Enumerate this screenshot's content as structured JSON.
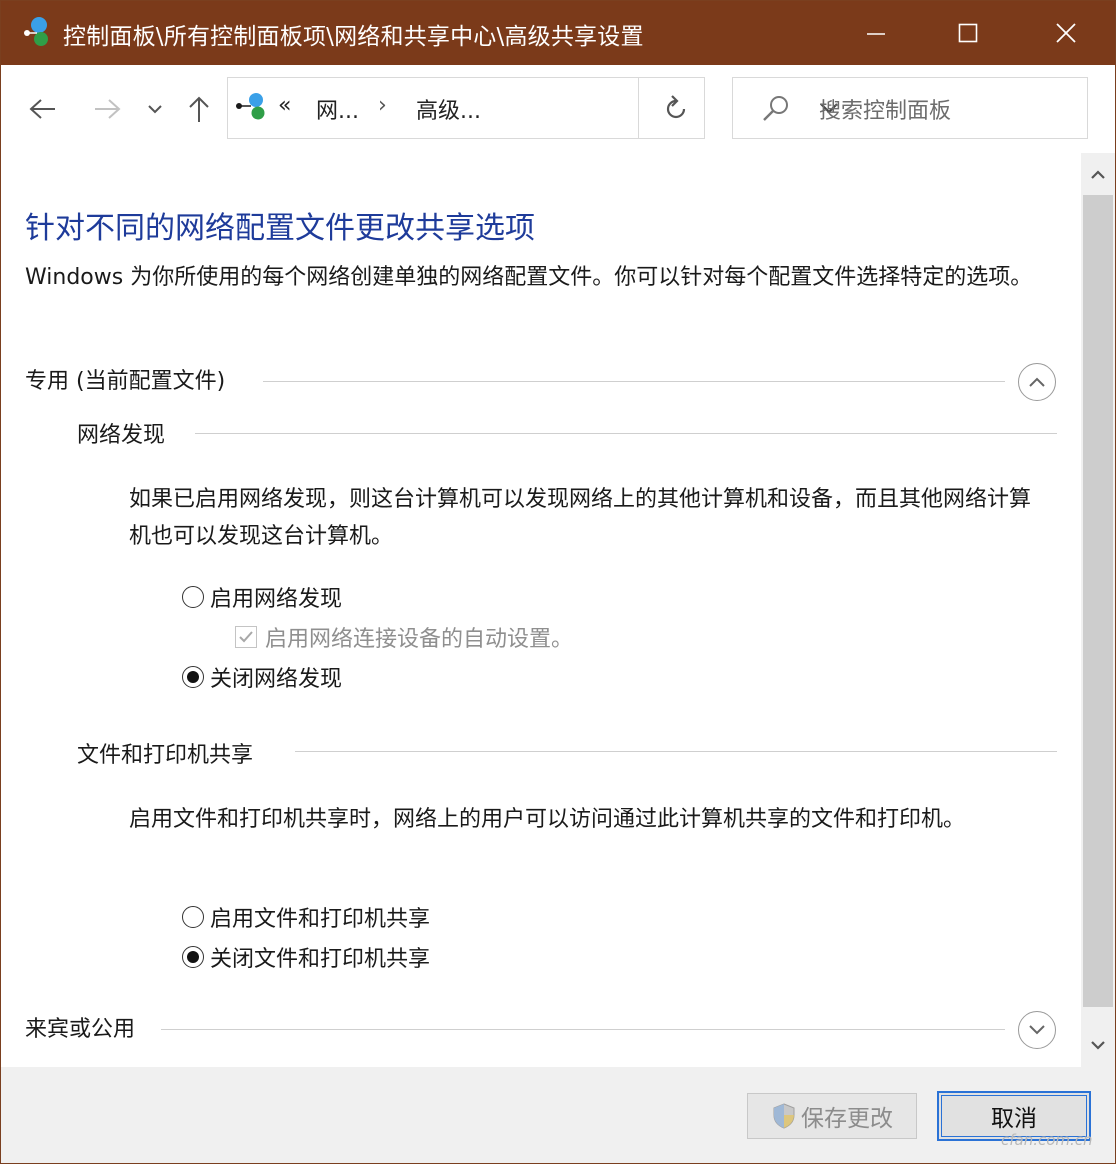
{
  "window": {
    "title": "控制面板\\所有控制面板项\\网络和共享中心\\高级共享设置"
  },
  "address": {
    "overflow": "«",
    "crumbs": [
      "网...",
      "高级..."
    ],
    "crumb_separator": "›"
  },
  "search": {
    "placeholder": "搜索控制面板"
  },
  "content": {
    "title": "针对不同的网络配置文件更改共享选项",
    "description": "Windows 为你所使用的每个网络创建单独的网络配置文件。你可以针对每个配置文件选择特定的选项。",
    "private_profile": {
      "heading": "专用 (当前配置文件)",
      "expanded": true,
      "network_discovery": {
        "heading": "网络发现",
        "description": "如果已启用网络发现，则这台计算机可以发现网络上的其他计算机和设备，而且其他网络计算机也可以发现这台计算机。",
        "options": [
          {
            "label": "启用网络发现",
            "selected": false
          },
          {
            "label": "关闭网络发现",
            "selected": true
          }
        ],
        "auto_setup": {
          "label": "启用网络连接设备的自动设置。",
          "checked": true,
          "disabled": true
        }
      },
      "file_printer_sharing": {
        "heading": "文件和打印机共享",
        "description": "启用文件和打印机共享时，网络上的用户可以访问通过此计算机共享的文件和打印机。",
        "options": [
          {
            "label": "启用文件和打印机共享",
            "selected": false
          },
          {
            "label": "关闭文件和打印机共享",
            "selected": true
          }
        ]
      }
    },
    "guest_profile": {
      "heading": "来宾或公用",
      "expanded": false
    }
  },
  "footer": {
    "save_label": "保存更改",
    "cancel_label": "取消"
  },
  "watermark": "cfan.com.cn",
  "colors": {
    "titlebar": "#7b3a1a",
    "title_link": "#1e3b9a",
    "focus_border": "#2a72d6"
  },
  "icons": {
    "app": "network-icon",
    "back": "arrow-left-icon",
    "forward": "arrow-right-icon",
    "recent": "chevron-down-icon",
    "up": "arrow-up-icon",
    "refresh": "refresh-icon",
    "search": "search-icon",
    "collapse": "chevron-up-circle-icon",
    "expand": "chevron-down-circle-icon",
    "shield": "uac-shield-icon"
  }
}
